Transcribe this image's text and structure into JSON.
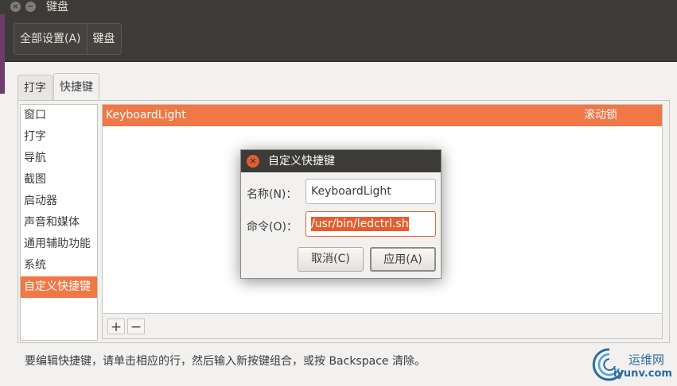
{
  "window": {
    "title": "键盘",
    "close_symbol": "×",
    "minimize_symbol": "−"
  },
  "breadcrumbs": [
    "全部设置(A)",
    "键盘"
  ],
  "tabs": [
    {
      "label": "打字",
      "active": false
    },
    {
      "label": "快捷键",
      "active": true
    }
  ],
  "categories": [
    "窗口",
    "打字",
    "导航",
    "截图",
    "启动器",
    "声音和媒体",
    "通用辅助功能",
    "系统",
    "自定义快捷键"
  ],
  "selected_category": "自定义快捷键",
  "shortcuts": [
    {
      "name": "KeyboardLight",
      "accelerator": "滚动锁"
    }
  ],
  "list_toolbar": {
    "add": "+",
    "remove": "−"
  },
  "hint": "要编辑快捷键，请单击相应的行，然后输入新按键组合，或按 Backspace 清除。",
  "dialog": {
    "title": "自定义快捷键",
    "close_symbol": "×",
    "name_label": "名称(N)：",
    "name_value": "KeyboardLight",
    "command_label": "命令(O)：",
    "command_value": "/usr/bin/ledctrl.sh",
    "cancel_label": "取消(C)",
    "apply_label": "应用(A)"
  },
  "watermark": {
    "line1": "运维网",
    "line2": "iyunv.com"
  },
  "colors": {
    "accent": "#f07746",
    "titlebar": "#3c3b37",
    "background": "#f2f1f0"
  }
}
